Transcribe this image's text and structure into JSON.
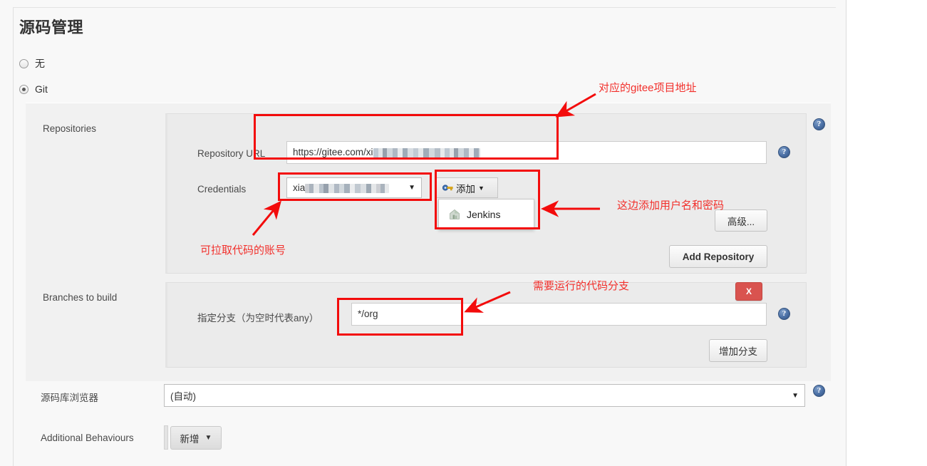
{
  "page": {
    "title": "源码管理"
  },
  "scm_options": [
    {
      "label": "无",
      "selected": false
    },
    {
      "label": "Git",
      "selected": true
    }
  ],
  "git": {
    "repositories": {
      "label": "Repositories",
      "url_field": {
        "label": "Repository URL",
        "value": "https://gitee.com/xi",
        "redacted": true
      },
      "credentials": {
        "label": "Credentials",
        "value": "xia",
        "redacted": true,
        "caret": "▼"
      },
      "add_button": {
        "label": "添加",
        "icon": "key-icon",
        "caret": "▼"
      },
      "add_menu": {
        "items": [
          {
            "label": "Jenkins",
            "icon": "jenkins-icon"
          }
        ]
      },
      "advanced_button": "高级...",
      "add_repository_button": "Add Repository"
    },
    "branches": {
      "label": "Branches to build",
      "branch_field": {
        "label": "指定分支（为空时代表any）",
        "value": "*/org"
      },
      "delete_button": "X",
      "add_branch_button": "增加分支"
    },
    "browser": {
      "label": "源码库浏览器",
      "value": "(自动)",
      "caret": "▼"
    },
    "additional_behaviours": {
      "label": "Additional Behaviours",
      "button": "新增",
      "caret": "▼"
    }
  },
  "help_icons": {
    "glyph": "?"
  },
  "annotations": [
    {
      "id": "url-note",
      "text": "对应的gitee项目地址"
    },
    {
      "id": "cred-note",
      "text": "可拉取代码的账号"
    },
    {
      "id": "addcred-note",
      "text": "这边添加用户名和密码"
    },
    {
      "id": "branch-note",
      "text": "需要运行的代码分支"
    }
  ],
  "colors": {
    "annotation_red": "#f30b0b",
    "annotation_text_red": "#f2302c",
    "panel_bg": "#f8f8f8",
    "block_bg": "#f1f1f1",
    "subpanel_bg": "#ebebeb",
    "danger": "#d9534f",
    "help_blue": "#4a6fa5"
  }
}
